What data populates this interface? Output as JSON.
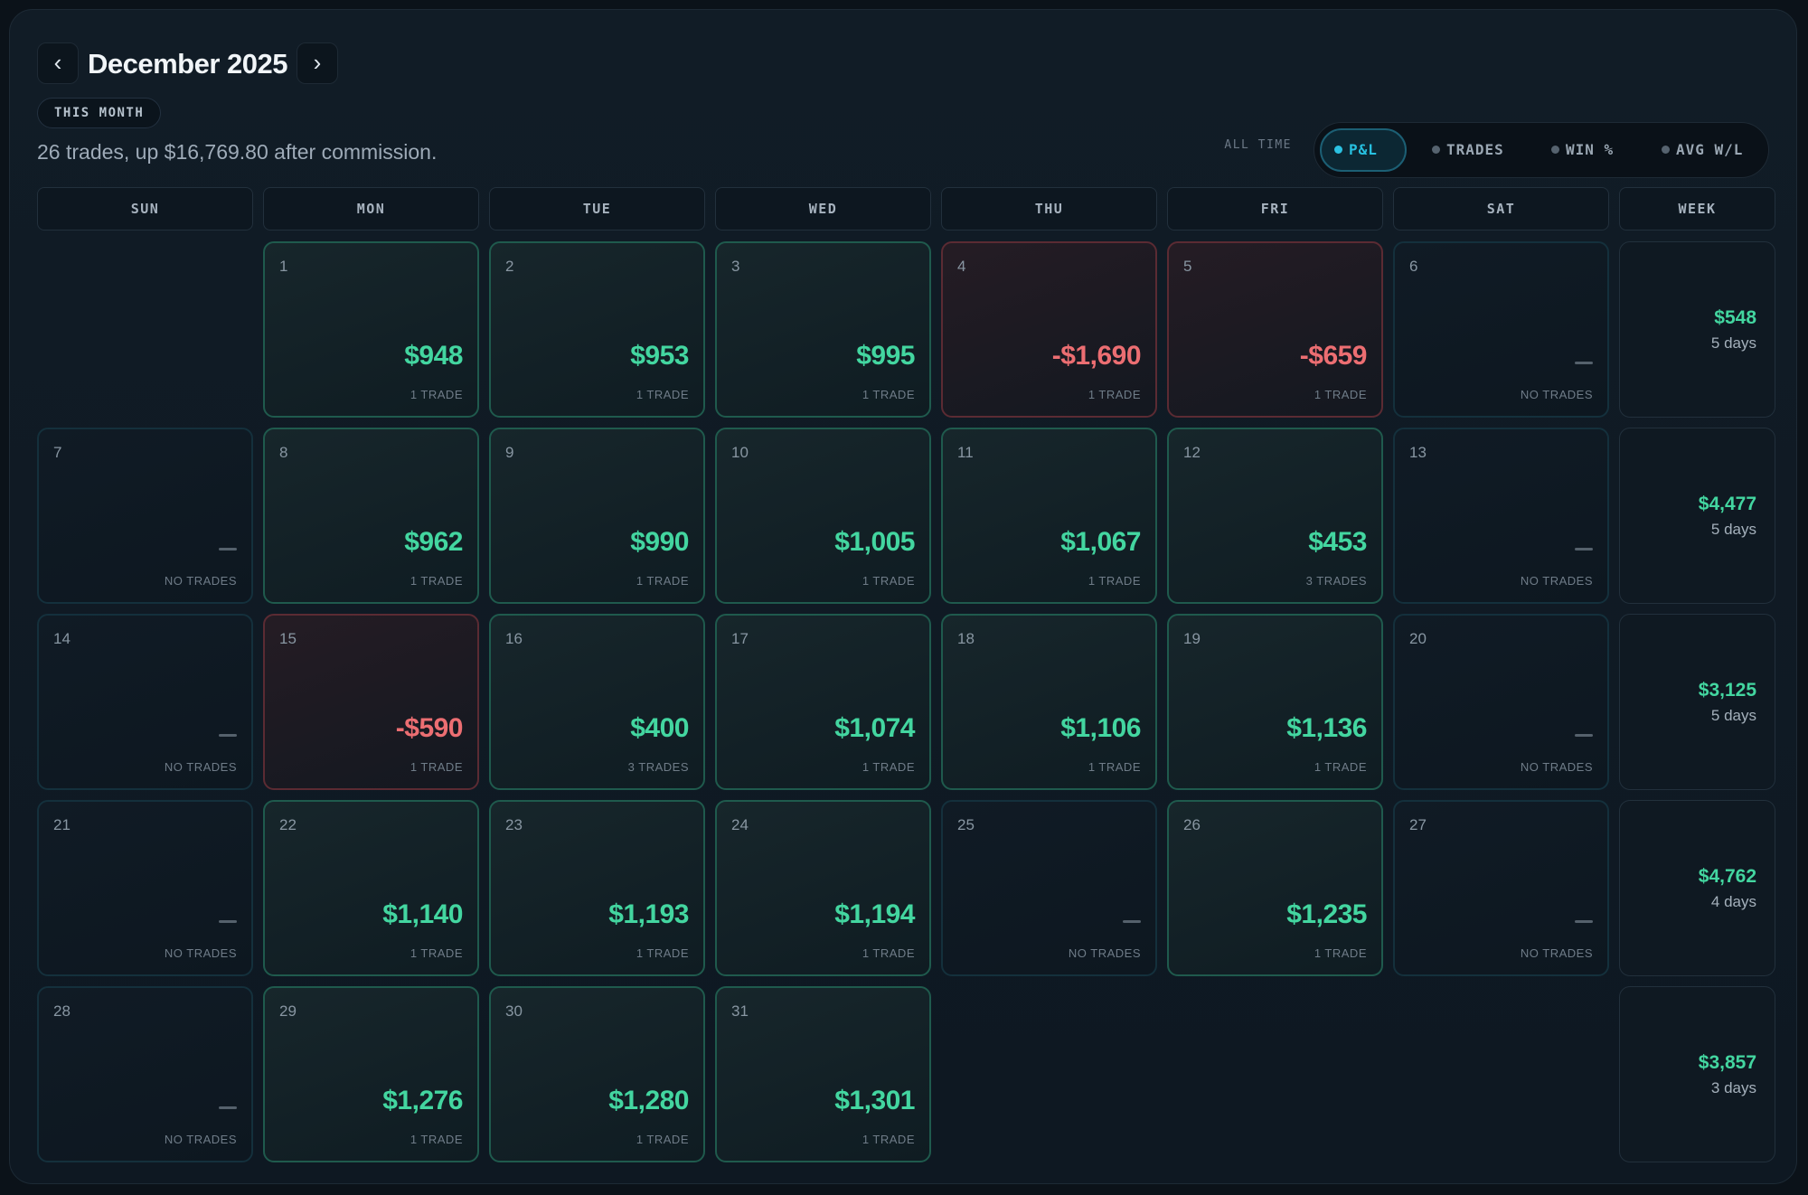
{
  "header": {
    "prev_icon": "chevron-left-icon",
    "next_icon": "chevron-right-icon",
    "prev_glyph": "‹",
    "next_glyph": "›",
    "title": "December 2025",
    "period_badge": "THIS MONTH",
    "summary": "26 trades, up $16,769.80 after commission.",
    "scope_label": "ALL TIME",
    "metrics": [
      "P&L",
      "TRADES",
      "WIN %",
      "AVG W/L"
    ],
    "active_metric": "P&L"
  },
  "colors": {
    "positive": "#43d6a0",
    "negative": "#ec6e72",
    "accent": "#27c0e0"
  },
  "weekdays": [
    "SUN",
    "MON",
    "TUE",
    "WED",
    "THU",
    "FRI",
    "SAT"
  ],
  "week_column_label": "WEEK",
  "weeks": [
    {
      "days": [
        null,
        {
          "day": "1",
          "status": "pos",
          "amount": "$948",
          "trades": "1 TRADE"
        },
        {
          "day": "2",
          "status": "pos",
          "amount": "$953",
          "trades": "1 TRADE"
        },
        {
          "day": "3",
          "status": "pos",
          "amount": "$995",
          "trades": "1 TRADE"
        },
        {
          "day": "4",
          "status": "neg",
          "amount": "-$1,690",
          "trades": "1 TRADE"
        },
        {
          "day": "5",
          "status": "neg",
          "amount": "-$659",
          "trades": "1 TRADE"
        },
        {
          "day": "6",
          "status": "none",
          "amount": "",
          "trades": "NO TRADES"
        }
      ],
      "summary": {
        "amount": "$548",
        "days": "5 days"
      }
    },
    {
      "days": [
        {
          "day": "7",
          "status": "none",
          "amount": "",
          "trades": "NO TRADES"
        },
        {
          "day": "8",
          "status": "pos",
          "amount": "$962",
          "trades": "1 TRADE"
        },
        {
          "day": "9",
          "status": "pos",
          "amount": "$990",
          "trades": "1 TRADE"
        },
        {
          "day": "10",
          "status": "pos",
          "amount": "$1,005",
          "trades": "1 TRADE"
        },
        {
          "day": "11",
          "status": "pos",
          "amount": "$1,067",
          "trades": "1 TRADE"
        },
        {
          "day": "12",
          "status": "pos",
          "amount": "$453",
          "trades": "3 TRADES"
        },
        {
          "day": "13",
          "status": "none",
          "amount": "",
          "trades": "NO TRADES"
        }
      ],
      "summary": {
        "amount": "$4,477",
        "days": "5 days"
      }
    },
    {
      "days": [
        {
          "day": "14",
          "status": "none",
          "amount": "",
          "trades": "NO TRADES"
        },
        {
          "day": "15",
          "status": "neg",
          "amount": "-$590",
          "trades": "1 TRADE"
        },
        {
          "day": "16",
          "status": "pos",
          "amount": "$400",
          "trades": "3 TRADES"
        },
        {
          "day": "17",
          "status": "pos",
          "amount": "$1,074",
          "trades": "1 TRADE"
        },
        {
          "day": "18",
          "status": "pos",
          "amount": "$1,106",
          "trades": "1 TRADE"
        },
        {
          "day": "19",
          "status": "pos",
          "amount": "$1,136",
          "trades": "1 TRADE"
        },
        {
          "day": "20",
          "status": "none",
          "amount": "",
          "trades": "NO TRADES"
        }
      ],
      "summary": {
        "amount": "$3,125",
        "days": "5 days"
      }
    },
    {
      "days": [
        {
          "day": "21",
          "status": "none",
          "amount": "",
          "trades": "NO TRADES"
        },
        {
          "day": "22",
          "status": "pos",
          "amount": "$1,140",
          "trades": "1 TRADE"
        },
        {
          "day": "23",
          "status": "pos",
          "amount": "$1,193",
          "trades": "1 TRADE"
        },
        {
          "day": "24",
          "status": "pos",
          "amount": "$1,194",
          "trades": "1 TRADE"
        },
        {
          "day": "25",
          "status": "none",
          "amount": "",
          "trades": "NO TRADES"
        },
        {
          "day": "26",
          "status": "pos",
          "amount": "$1,235",
          "trades": "1 TRADE"
        },
        {
          "day": "27",
          "status": "none",
          "amount": "",
          "trades": "NO TRADES"
        }
      ],
      "summary": {
        "amount": "$4,762",
        "days": "4 days"
      }
    },
    {
      "days": [
        {
          "day": "28",
          "status": "none",
          "amount": "",
          "trades": "NO TRADES"
        },
        {
          "day": "29",
          "status": "pos",
          "amount": "$1,276",
          "trades": "1 TRADE"
        },
        {
          "day": "30",
          "status": "pos",
          "amount": "$1,280",
          "trades": "1 TRADE"
        },
        {
          "day": "31",
          "status": "pos",
          "amount": "$1,301",
          "trades": "1 TRADE"
        },
        null,
        null,
        null
      ],
      "summary": {
        "amount": "$3,857",
        "days": "3 days"
      }
    }
  ]
}
